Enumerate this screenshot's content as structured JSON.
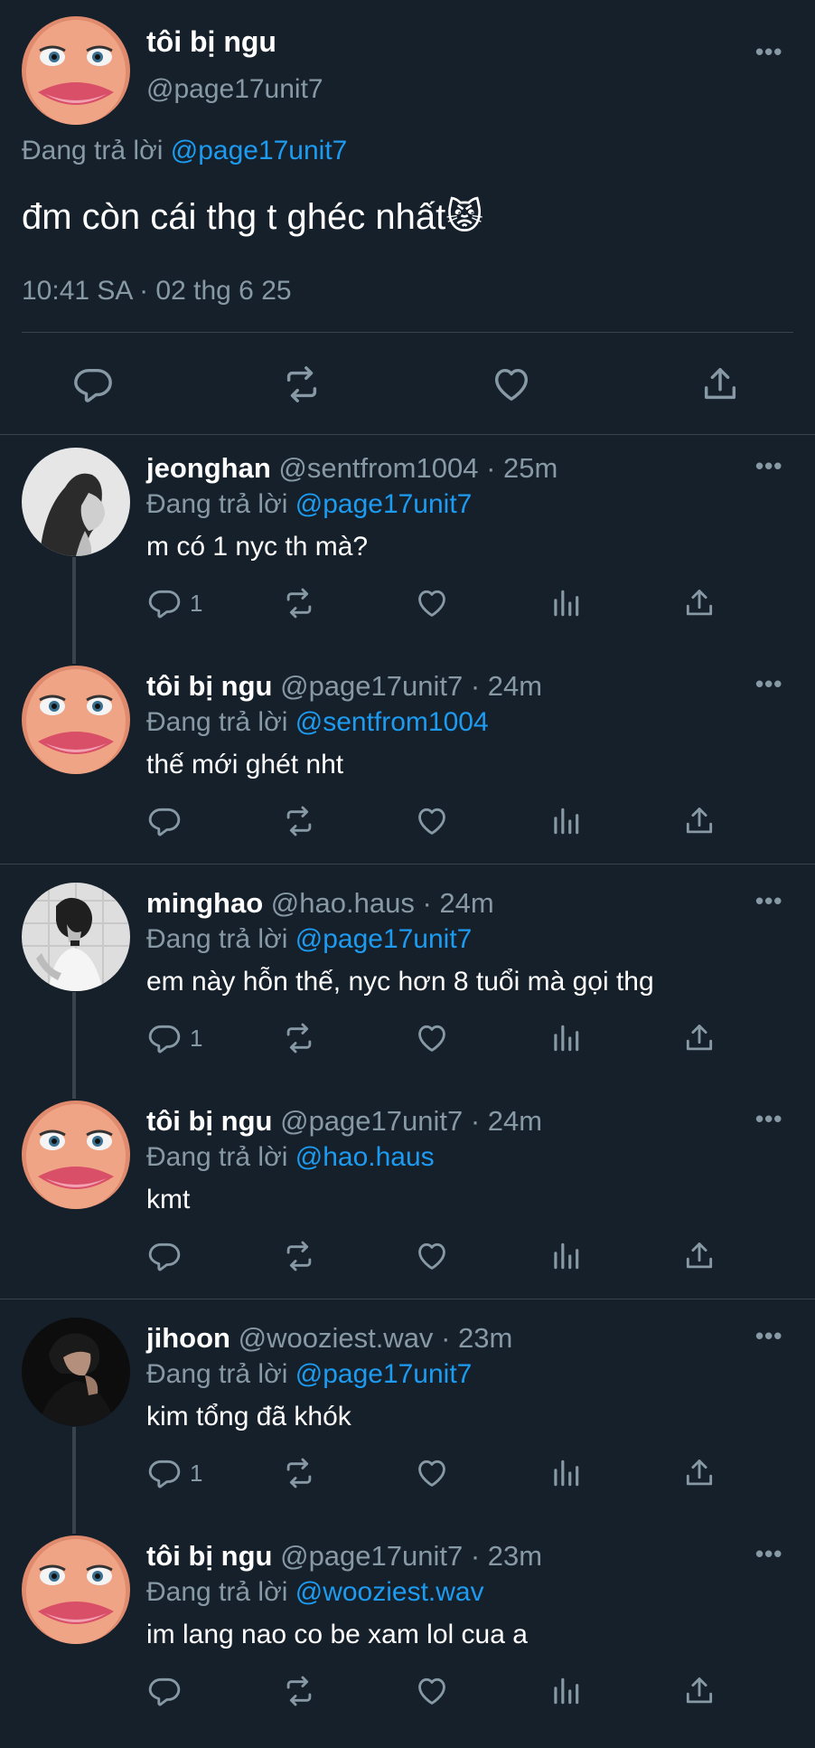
{
  "main_tweet": {
    "name": "tôi bị ngu",
    "handle": "@page17unit7",
    "reply_prefix": "Đang trả lời",
    "reply_to": "@page17unit7",
    "text": "đm còn cái thg t ghéc nhất",
    "emoji": "😾",
    "timestamp": "10:41 SA · 02 thg 6 25",
    "avatar": "cartoon-face-avatar",
    "actions": [
      "reply-icon",
      "retweet-icon",
      "like-icon",
      "share-icon"
    ]
  },
  "replies": [
    {
      "name": "jeonghan",
      "handle": "@sentfrom1004",
      "time": "· 25m",
      "reply_prefix": "Đang trả lời",
      "reply_to": "@page17unit7",
      "text": "m có 1 nyc th mà?",
      "reply_count": "1",
      "avatar": "portrait-profile-avatar"
    },
    {
      "name": "tôi bị ngu",
      "handle": "@page17unit7",
      "time": "· 24m",
      "reply_prefix": "Đang trả lời",
      "reply_to": "@sentfrom1004",
      "text": "thế mới ghét nht",
      "reply_count": "",
      "avatar": "cartoon-face-avatar"
    },
    {
      "name": "minghao",
      "handle": "@hao.haus",
      "time": "· 24m",
      "reply_prefix": "Đang trả lời",
      "reply_to": "@page17unit7",
      "text": "em này hỗn thế, nyc hơn 8 tuổi mà gọi thg",
      "reply_count": "1",
      "avatar": "bw-photo-avatar"
    },
    {
      "name": "tôi bị ngu",
      "handle": "@page17unit7",
      "time": "· 24m",
      "reply_prefix": "Đang trả lời",
      "reply_to": "@hao.haus",
      "text": "kmt",
      "reply_count": "",
      "avatar": "cartoon-face-avatar"
    },
    {
      "name": "jihoon",
      "handle": "@wooziest.wav",
      "time": "· 23m",
      "reply_prefix": "Đang trả lời",
      "reply_to": "@page17unit7",
      "text": "kim tổng đã khók",
      "reply_count": "1",
      "avatar": "dark-photo-avatar"
    },
    {
      "name": "tôi bị ngu",
      "handle": "@page17unit7",
      "time": "· 23m",
      "reply_prefix": "Đang trả lời",
      "reply_to": "@wooziest.wav",
      "text": "im lang nao co be xam lol cua a",
      "reply_count": "",
      "avatar": "cartoon-face-avatar"
    }
  ],
  "more_label": "•••",
  "colors": {
    "background": "#15202b",
    "text": "#ffffff",
    "secondary": "#8899a6",
    "accent": "#1d9bf0",
    "divider": "#38444d"
  }
}
